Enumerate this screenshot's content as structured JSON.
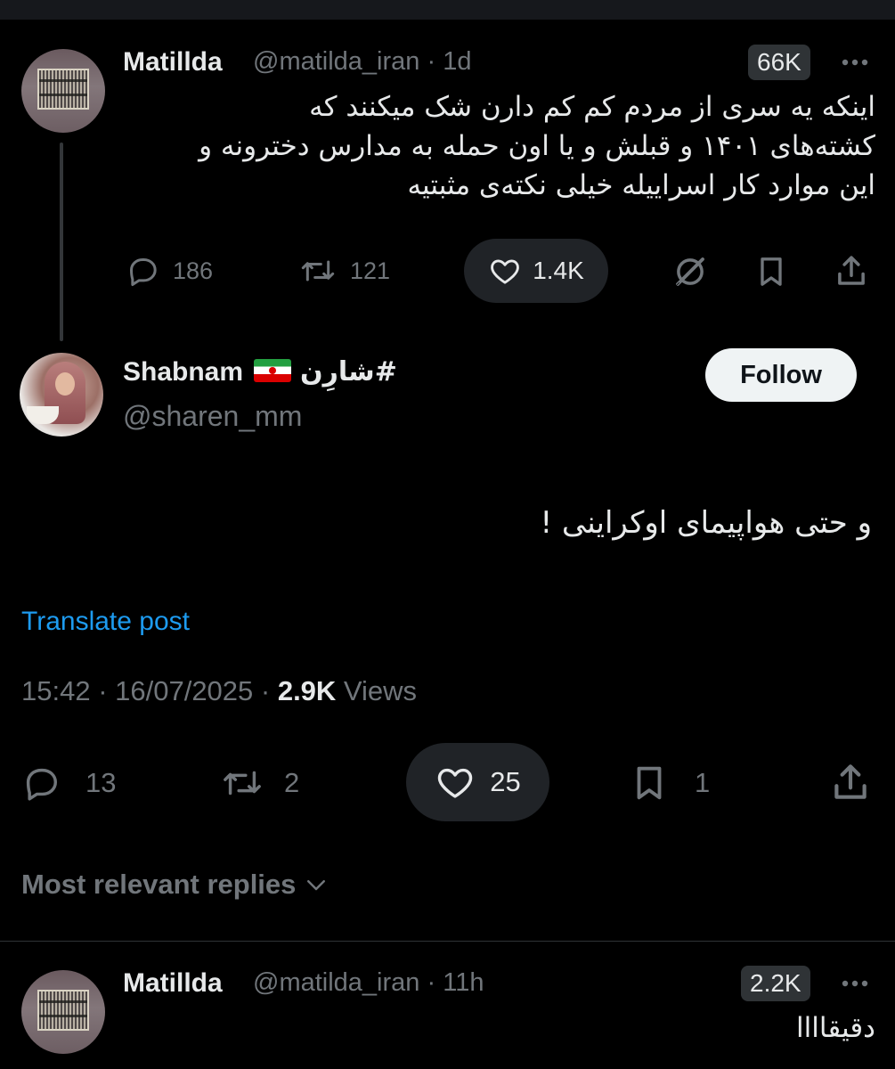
{
  "parent_tweet": {
    "display_name": "Matillda",
    "handle": "@matilda_iran",
    "separator": "·",
    "age": "1d",
    "views_badge": "66K",
    "text_lines": [
      "اینکه یه سری از مردم کم کم دارن شک میکنند که",
      "کشته‌های ۱۴۰۱ و قبلش و یا اون حمله به مدارس دخترونه و",
      "این موارد کار اسراییله خیلی نکته‌ی مثبتیه"
    ],
    "actions": {
      "replies": "186",
      "reposts": "121",
      "likes": "1.4K"
    },
    "icons": [
      "reply-icon",
      "repost-icon",
      "heart-icon",
      "grok-icon",
      "bookmark-icon",
      "share-icon",
      "more-icon"
    ]
  },
  "main_tweet": {
    "display_name": "Shabnam",
    "flag_emoji": "iran-flag",
    "hashtag": "شارِن#",
    "handle": "@sharen_mm",
    "follow_label": "Follow",
    "text": "و حتی هواپیمای اوکراینی !",
    "translate_label": "Translate post",
    "timestamp": "15:42 · 16/07/2025 · ",
    "views_count": "2.9K",
    "views_label": " Views",
    "actions": {
      "replies": "13",
      "reposts": "2",
      "likes": "25",
      "bookmarks": "1"
    }
  },
  "replies_sort_label": "Most relevant replies",
  "reply_tweet": {
    "display_name": "Matillda",
    "handle": "@matilda_iran",
    "separator": "·",
    "age": "11h",
    "views_badge": "2.2K",
    "text": "دقیقاااا"
  },
  "colors": {
    "background": "#000000",
    "text": "#e7e9ea",
    "muted": "#71767b",
    "link": "#1d9bf0",
    "pill": "#202327",
    "follow_bg": "#eff3f4"
  }
}
